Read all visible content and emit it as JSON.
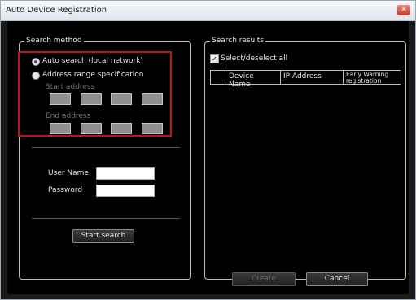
{
  "window": {
    "title": "Auto Device Registration",
    "close_glyph": "✕"
  },
  "search_method": {
    "legend": "Search method",
    "auto_search_label": "Auto search (local network)",
    "range_label": "Address range specification",
    "start_address_label": "Start address",
    "end_address_label": "End address",
    "user_name_label": "User Name",
    "password_label": "Password",
    "start_search_button": "Start search"
  },
  "search_results": {
    "legend": "Search results",
    "select_all_label": "Select/deselect all",
    "columns": [
      "Device Name",
      "IP Address",
      "Early Warning registration"
    ]
  },
  "footer": {
    "create_button": "Create",
    "cancel_button": "Cancel"
  }
}
